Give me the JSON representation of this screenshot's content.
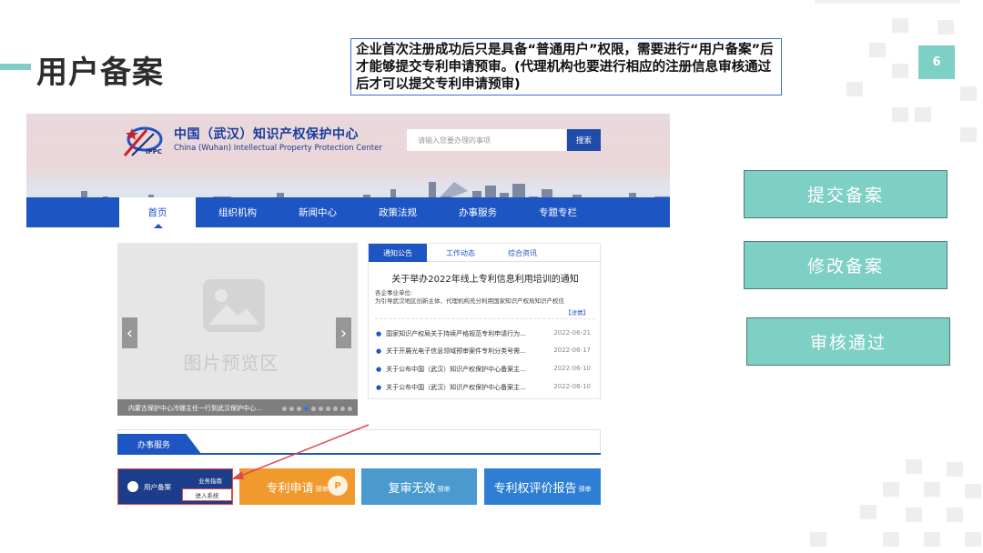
{
  "slide": {
    "title": "用户备案",
    "note": "企业首次注册成功后只是具备“普通用户”权限，需要进行“用户备案”后才能够提交专利申请预审。(代理机构也要进行相应的注册信息审核通过后才可以提交专利申请预审)",
    "page_number": "6"
  },
  "site": {
    "name_cn": "中国（武汉）知识产权保护中心",
    "name_en": "China (Wuhan) Intellectual Property Protection Center",
    "logo_text": "IPPC",
    "search_placeholder": "请输入您要办理的事项",
    "search_button": "搜索"
  },
  "nav": [
    "首页",
    "组织机构",
    "新闻中心",
    "政策法规",
    "办事服务",
    "专题专栏"
  ],
  "slider": {
    "placeholder_text": "图片预览区",
    "caption": "内蒙古保护中心冷娜主任一行到武汉保护中心...",
    "prev": "‹",
    "next": "›"
  },
  "notices": {
    "tabs": [
      "通知公告",
      "工作动态",
      "综合资讯"
    ],
    "headline": "关于举办2022年线上专利信息利用培训的通知",
    "unit": "各企事业单位:",
    "desc": "为引导武汉地区创新主体、代理机构充分利用国家知识产权局知识产权信",
    "detail": "【详情】",
    "items": [
      {
        "title": "国家知识产权局关于持续严格规范专利申请行为...",
        "date": "2022-06-21"
      },
      {
        "title": "关于开展光电子信息领域预审案件专利分类号需...",
        "date": "2022-06-17"
      },
      {
        "title": "关于公布中国（武汉）知识产权保护中心备案主...",
        "date": "2022-06-10"
      },
      {
        "title": "关于公布中国（武汉）知识产权保护中心备案主...",
        "date": "2022-06-10"
      }
    ]
  },
  "services": {
    "tab": "办事服务",
    "card1": {
      "label": "用户备案",
      "guide": "业务指南",
      "enter": "进入系统"
    },
    "card2": {
      "label": "专利申请",
      "sub": "预审",
      "badge": "P"
    },
    "card3": {
      "label": "复审无效",
      "sub": "预审"
    },
    "card4": {
      "label": "专利权评价报告",
      "sub": "预审"
    }
  },
  "steps": [
    "提交备案",
    "修改备案",
    "审核通过"
  ],
  "colors": {
    "accent": "#7ecfc4",
    "nav_blue": "#1d55c2",
    "annotation_red": "#e04a4a"
  }
}
